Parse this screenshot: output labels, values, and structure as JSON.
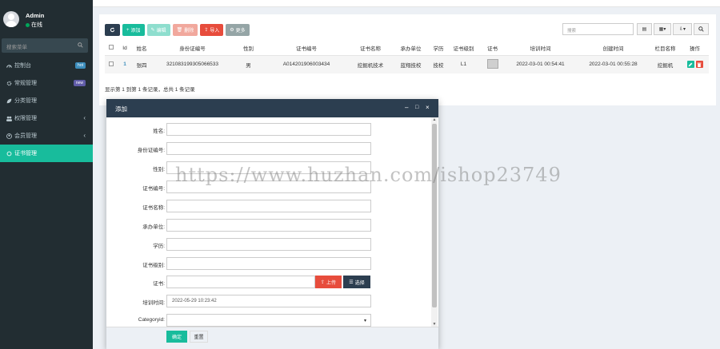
{
  "sidebar": {
    "user": {
      "name": "Admin",
      "status": "在线"
    },
    "search_placeholder": "搜索菜单",
    "items": [
      {
        "label": "控制台",
        "icon": "dashboard-icon",
        "badge": "hot"
      },
      {
        "label": "常规管理",
        "icon": "cogs-icon",
        "badge": "new"
      },
      {
        "label": "分类管理",
        "icon": "leaf-icon"
      },
      {
        "label": "权限管理",
        "icon": "group-icon"
      },
      {
        "label": "会员管理",
        "icon": "user-circle-icon"
      },
      {
        "label": "证书管理",
        "icon": "circle-icon"
      }
    ]
  },
  "toolbar": {
    "refresh": "",
    "add": "添加",
    "edit": "编辑",
    "delete": "删除",
    "import": "导入",
    "more": "更多",
    "search_placeholder": "搜索"
  },
  "table": {
    "headers": [
      "",
      "Id",
      "姓名",
      "身份证编号",
      "性别",
      "证书编号",
      "证书名称",
      "承办单位",
      "学历",
      "证书级别",
      "证书",
      "培训时间",
      "创建时间",
      "栏目名称",
      "操作"
    ],
    "rows": [
      [
        "",
        "1",
        "张四",
        "321083199305066533",
        "男",
        "A014201906003434",
        "挖掘机技术",
        "蓝翔技校",
        "技校",
        "L1",
        "",
        "2022-03-01 00:54:41",
        "2022-03-01 00:55:28",
        "挖掘机",
        ""
      ]
    ],
    "page_info": "显示第 1 到第 1 条记录，总共 1 条记录"
  },
  "modal": {
    "title": "添加",
    "fields": [
      {
        "label": "姓名:",
        "value": ""
      },
      {
        "label": "身份证编号:",
        "value": ""
      },
      {
        "label": "性别:",
        "value": ""
      },
      {
        "label": "证书编号:",
        "value": ""
      },
      {
        "label": "证书名称:",
        "value": ""
      },
      {
        "label": "承办单位:",
        "value": ""
      },
      {
        "label": "学历:",
        "value": ""
      },
      {
        "label": "证书级别:",
        "value": ""
      },
      {
        "label": "证书:",
        "value": ""
      },
      {
        "label": "培训时间:",
        "value": "2022-05-29 10:23:42"
      },
      {
        "label": "Categoryid:",
        "value": ""
      }
    ],
    "upload_label": "上传",
    "choose_label": "选择",
    "ok_label": "确定",
    "reset_label": "重置"
  },
  "watermark": "https://www.huzhan.com/ishop23749",
  "colors": {
    "sidebar": "#222d32",
    "accent": "#18bc9c",
    "danger": "#e74c3c",
    "header": "#2c3e50"
  }
}
